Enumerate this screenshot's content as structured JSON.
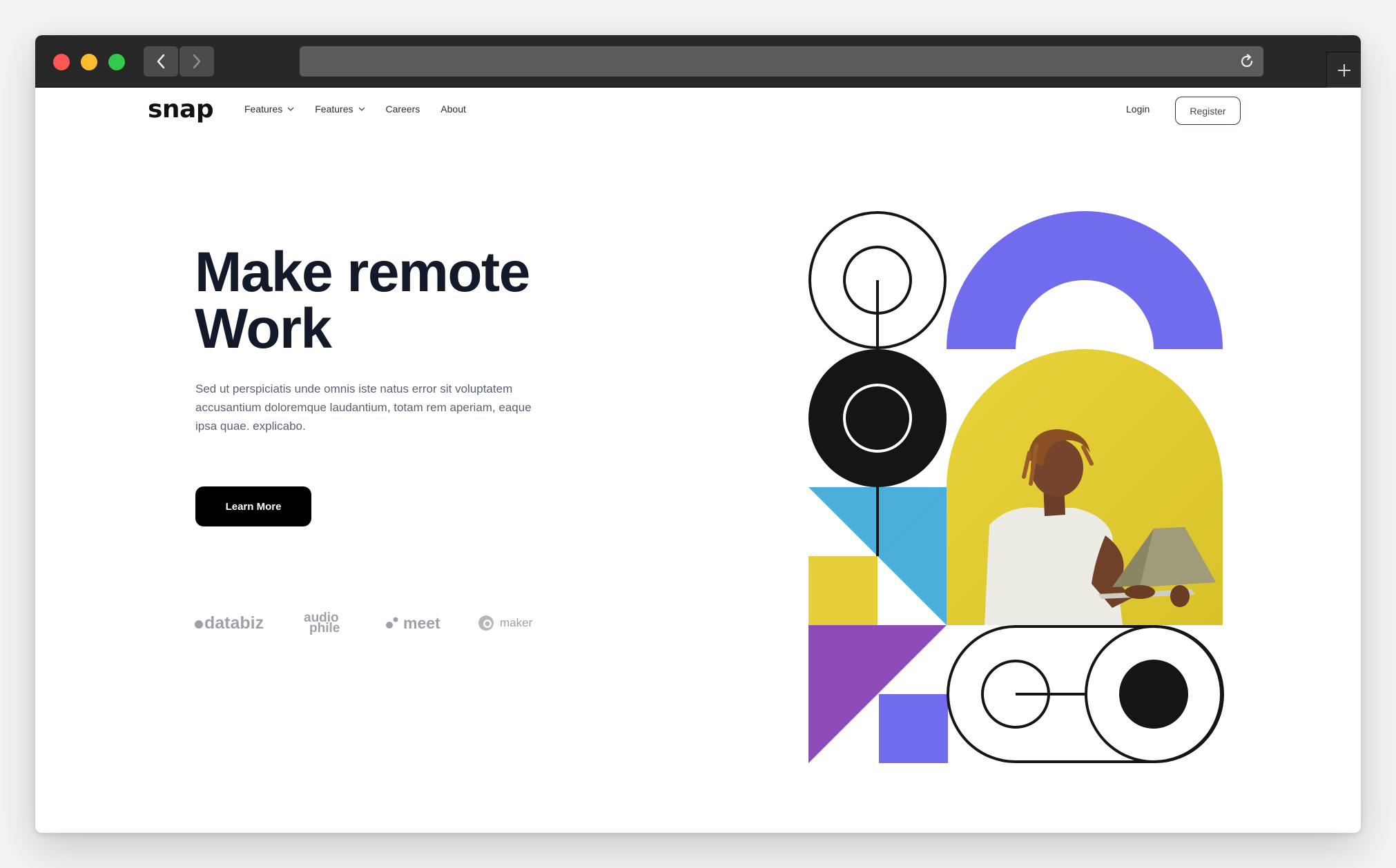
{
  "browser": {
    "url": ""
  },
  "nav": {
    "logo": "snap",
    "links": [
      {
        "label": "Features",
        "dropdown": true
      },
      {
        "label": "Features",
        "dropdown": true
      },
      {
        "label": "Careers",
        "dropdown": false
      },
      {
        "label": "About",
        "dropdown": false
      }
    ],
    "login": "Login",
    "register": "Register"
  },
  "hero": {
    "headline_line1": "Make remote",
    "headline_line2": "Work",
    "body": "Sed ut perspiciatis unde omnis iste natus error sit voluptatem accusantium doloremque laudantium, totam rem aperiam, eaque ipsa quae. explicabo.",
    "cta": "Learn More"
  },
  "clients": {
    "databiz": "databiz",
    "audiophile_1": "audio",
    "audiophile_2": "phile",
    "meet": "meet",
    "maker": "maker"
  },
  "colors": {
    "purple": "#706ced",
    "yellow": "#e6cf3a",
    "blue": "#4baedb",
    "violet": "#8c4bb6",
    "dark": "#151515"
  }
}
